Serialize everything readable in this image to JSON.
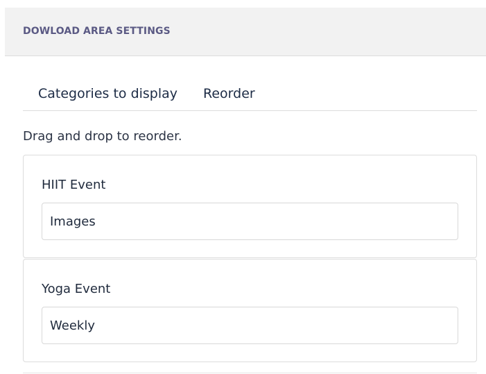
{
  "header": {
    "title": "DOWLOAD AREA SETTINGS"
  },
  "tabs": [
    {
      "label": "Categories to display"
    },
    {
      "label": "Reorder"
    }
  ],
  "hint": "Drag and drop to reorder.",
  "items": [
    {
      "label": "HIIT Event",
      "value": "Images"
    },
    {
      "label": "Yoga Event",
      "value": "Weekly"
    }
  ]
}
